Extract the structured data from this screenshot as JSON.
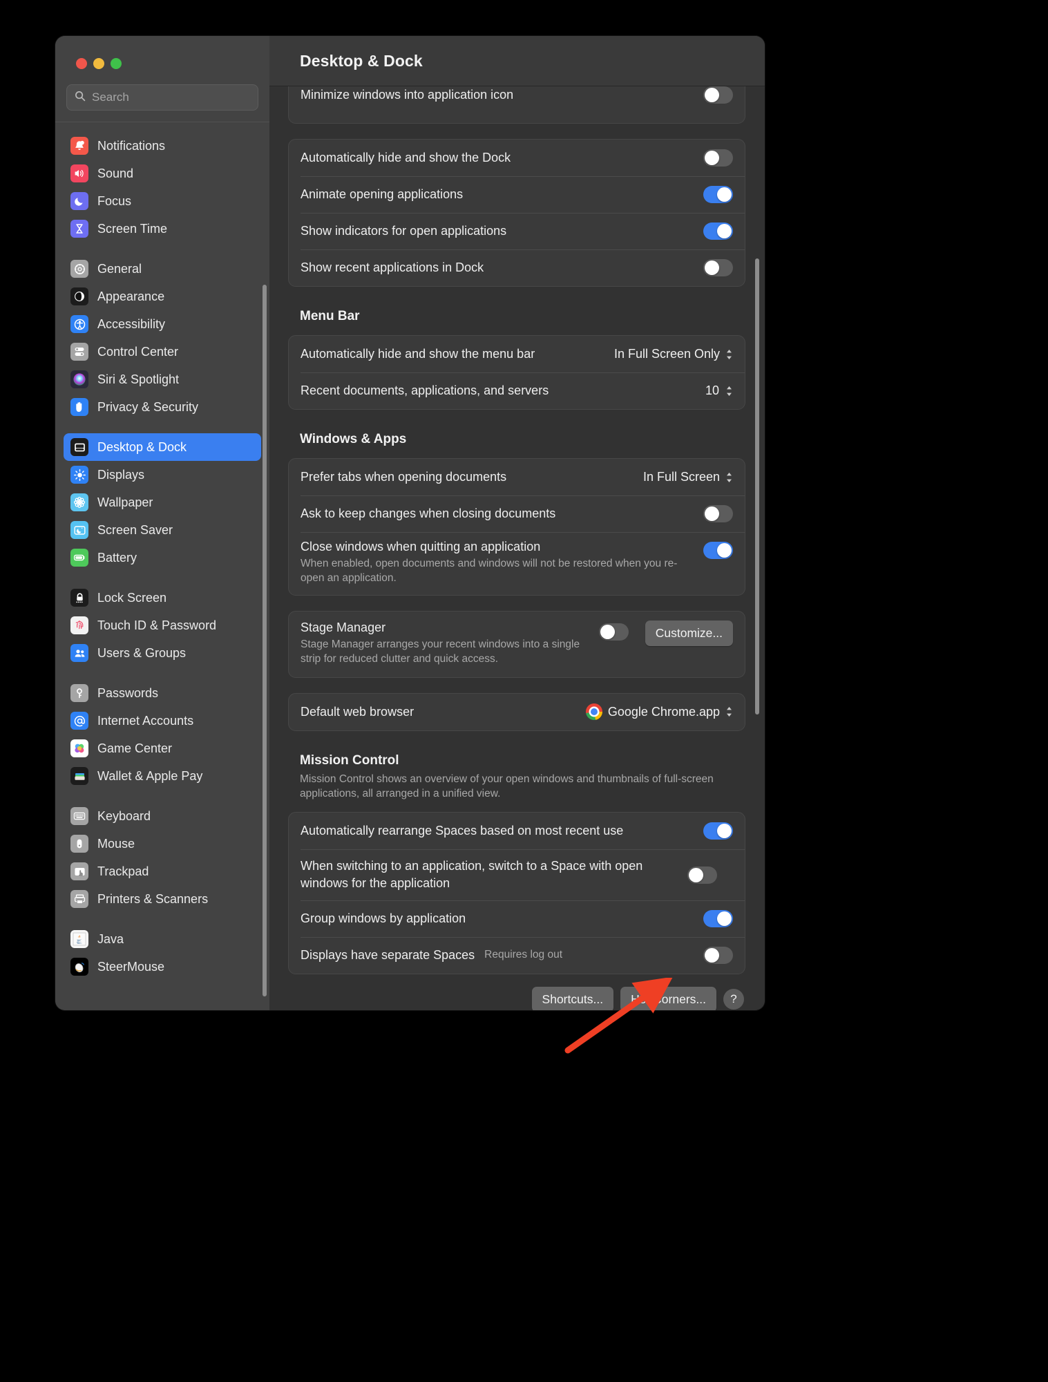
{
  "window": {
    "title": "Desktop & Dock",
    "traffic_lights": [
      "close",
      "minimize",
      "zoom"
    ]
  },
  "search": {
    "placeholder": "Search",
    "value": ""
  },
  "sidebar": {
    "groups": [
      {
        "items": [
          {
            "label": "Notifications",
            "icon": "notifications-icon",
            "color": "#f4584a",
            "selected": false
          },
          {
            "label": "Sound",
            "icon": "sound-icon",
            "color": "#f2465f",
            "selected": false
          },
          {
            "label": "Focus",
            "icon": "focus-icon",
            "color": "#6d6ef0",
            "selected": false
          },
          {
            "label": "Screen Time",
            "icon": "screen-time-icon",
            "color": "#6e6ef2",
            "selected": false
          }
        ]
      },
      {
        "items": [
          {
            "label": "General",
            "icon": "gear-icon",
            "color": "#a5a5a5",
            "selected": false
          },
          {
            "label": "Appearance",
            "icon": "appearance-icon",
            "color": "#1c1c1c",
            "selected": false
          },
          {
            "label": "Accessibility",
            "icon": "accessibility-icon",
            "color": "#2f82f5",
            "selected": false
          },
          {
            "label": "Control Center",
            "icon": "control-center-icon",
            "color": "#a5a5a5",
            "selected": false
          },
          {
            "label": "Siri & Spotlight",
            "icon": "siri-icon",
            "color": "#2a2a3a",
            "selected": false
          },
          {
            "label": "Privacy & Security",
            "icon": "privacy-hand-icon",
            "color": "#2f82f5",
            "selected": false
          }
        ]
      },
      {
        "items": [
          {
            "label": "Desktop & Dock",
            "icon": "desktop-dock-icon",
            "color": "#1c1c1c",
            "selected": true
          },
          {
            "label": "Displays",
            "icon": "displays-icon",
            "color": "#2f82f5",
            "selected": false
          },
          {
            "label": "Wallpaper",
            "icon": "wallpaper-icon",
            "color": "#5ec5f0",
            "selected": false
          },
          {
            "label": "Screen Saver",
            "icon": "screen-saver-icon",
            "color": "#55c2f2",
            "selected": false
          },
          {
            "label": "Battery",
            "icon": "battery-icon",
            "color": "#4ec95b",
            "selected": false
          }
        ]
      },
      {
        "items": [
          {
            "label": "Lock Screen",
            "icon": "lock-icon",
            "color": "#1c1c1c",
            "selected": false
          },
          {
            "label": "Touch ID & Password",
            "icon": "touch-id-icon",
            "color": "#f2f2f2",
            "selected": false
          },
          {
            "label": "Users & Groups",
            "icon": "users-groups-icon",
            "color": "#2f82f5",
            "selected": false
          }
        ]
      },
      {
        "items": [
          {
            "label": "Passwords",
            "icon": "key-icon",
            "color": "#a5a5a5",
            "selected": false
          },
          {
            "label": "Internet Accounts",
            "icon": "at-sign-icon",
            "color": "#2f82f5",
            "selected": false
          },
          {
            "label": "Game Center",
            "icon": "game-center-icon",
            "color": "#ffffff",
            "selected": false
          },
          {
            "label": "Wallet & Apple Pay",
            "icon": "wallet-icon",
            "color": "#1c1c1c",
            "selected": false
          }
        ]
      },
      {
        "items": [
          {
            "label": "Keyboard",
            "icon": "keyboard-icon",
            "color": "#a5a5a5",
            "selected": false
          },
          {
            "label": "Mouse",
            "icon": "mouse-icon",
            "color": "#a5a5a5",
            "selected": false
          },
          {
            "label": "Trackpad",
            "icon": "trackpad-icon",
            "color": "#a5a5a5",
            "selected": false
          },
          {
            "label": "Printers & Scanners",
            "icon": "printer-icon",
            "color": "#a5a5a5",
            "selected": false
          }
        ]
      },
      {
        "items": [
          {
            "label": "Java",
            "icon": "java-icon",
            "color": "#f7f7f7",
            "selected": false
          },
          {
            "label": "SteerMouse",
            "icon": "steermouse-icon",
            "color": "#000000",
            "selected": false
          }
        ]
      }
    ]
  },
  "main": {
    "dock_clipped_row": {
      "label": "Minimize windows into application icon",
      "toggle": "off"
    },
    "dock_card": [
      {
        "label": "Automatically hide and show the Dock",
        "toggle": "off"
      },
      {
        "label": "Animate opening applications",
        "toggle": "on"
      },
      {
        "label": "Show indicators for open applications",
        "toggle": "on"
      },
      {
        "label": "Show recent applications in Dock",
        "toggle": "off"
      }
    ],
    "menu_bar": {
      "heading": "Menu Bar",
      "rows": [
        {
          "label": "Automatically hide and show the menu bar",
          "control": "popup",
          "value": "In Full Screen Only"
        },
        {
          "label": "Recent documents, applications, and servers",
          "control": "stepper",
          "value": "10"
        }
      ]
    },
    "windows_apps": {
      "heading": "Windows & Apps",
      "rows": [
        {
          "label": "Prefer tabs when opening documents",
          "control": "popup",
          "value": "In Full Screen"
        },
        {
          "label": "Ask to keep changes when closing documents",
          "control": "toggle",
          "toggle": "off"
        },
        {
          "label": "Close windows when quitting an application",
          "sub": "When enabled, open documents and windows will not be restored when you re-open an application.",
          "control": "toggle",
          "toggle": "on"
        }
      ],
      "stage_manager": {
        "label": "Stage Manager",
        "sub": "Stage Manager arranges your recent windows into a single strip for reduced clutter and quick access.",
        "toggle": "off",
        "button": "Customize..."
      },
      "default_browser": {
        "label": "Default web browser",
        "value": "Google Chrome.app",
        "icon": "chrome-icon"
      }
    },
    "mission_control": {
      "heading": "Mission Control",
      "description": "Mission Control shows an overview of your open windows and thumbnails of full-screen applications, all arranged in a unified view.",
      "rows": [
        {
          "label": "Automatically rearrange Spaces based on most recent use",
          "toggle": "on"
        },
        {
          "label": "When switching to an application, switch to a Space with open windows for the application",
          "toggle": "off"
        },
        {
          "label": "Group windows by application",
          "toggle": "on"
        },
        {
          "label": "Displays have separate Spaces",
          "badge": "Requires log out",
          "toggle": "off"
        }
      ]
    },
    "footer": {
      "shortcuts_button": "Shortcuts...",
      "hot_corners_button": "Hot Corners...",
      "help_button": "?"
    }
  },
  "annotation": {
    "arrow": "red-arrow-pointing-to-hot-corners",
    "color": "#ef3f24"
  }
}
